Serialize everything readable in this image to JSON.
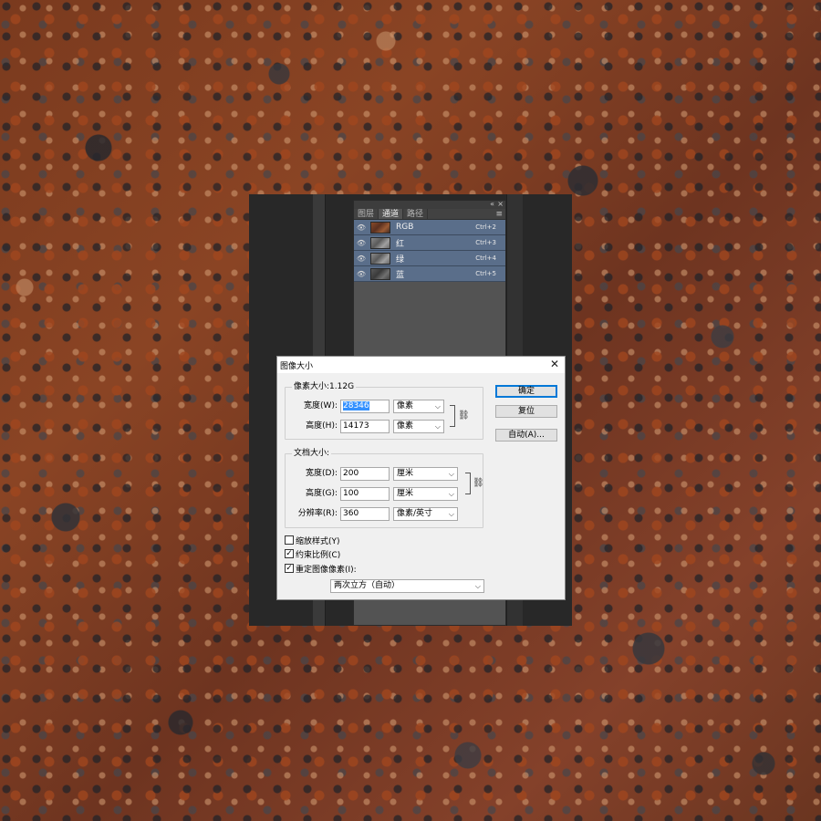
{
  "panel": {
    "tabs": [
      {
        "label": "图层"
      },
      {
        "label": "通道"
      },
      {
        "label": "路径"
      }
    ],
    "collapse_glyph": "«",
    "close_glyph": "×",
    "menu_glyph": "≡",
    "channels": [
      {
        "name": "RGB",
        "shortcut": "Ctrl+2"
      },
      {
        "name": "红",
        "shortcut": "Ctrl+3"
      },
      {
        "name": "绿",
        "shortcut": "Ctrl+4"
      },
      {
        "name": "蓝",
        "shortcut": "Ctrl+5"
      }
    ]
  },
  "dialog": {
    "title": "图像大小",
    "close_glyph": "✕",
    "pixel_group": {
      "label": "像素大小:1.12G",
      "width_label": "宽度(W):",
      "width_value": "28346",
      "width_unit": "像素",
      "height_label": "高度(H):",
      "height_value": "14173",
      "height_unit": "像素"
    },
    "doc_group": {
      "label": "文档大小:",
      "width_label": "宽度(D):",
      "width_value": "200",
      "width_unit": "厘米",
      "height_label": "高度(G):",
      "height_value": "100",
      "height_unit": "厘米",
      "res_label": "分辨率(R):",
      "res_value": "360",
      "res_unit": "像素/英寸"
    },
    "buttons": {
      "ok": "确定",
      "reset": "复位",
      "auto": "自动(A)..."
    },
    "checkboxes": {
      "scale_styles": {
        "label": "缩放样式(Y)",
        "checked": false
      },
      "constrain": {
        "label": "约束比例(C)",
        "checked": true
      },
      "resample": {
        "label": "重定图像像素(I):",
        "checked": true
      }
    },
    "resample_method": "两次立方（自动）"
  }
}
